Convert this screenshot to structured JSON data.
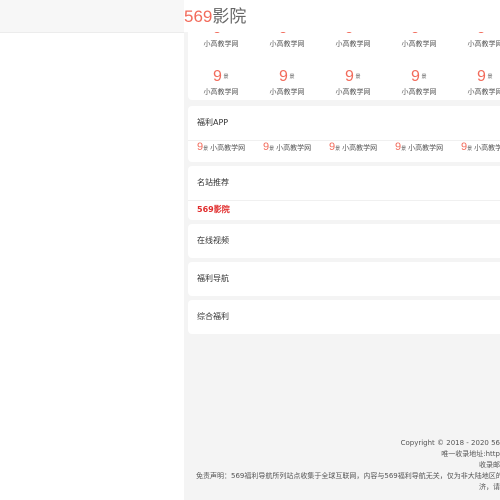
{
  "header": {
    "logo_number": "569",
    "logo_text": "影院"
  },
  "sites": {
    "logo_digit": "9",
    "logo_char": "景",
    "rows": [
      {
        "labels": [
          "小高教学网",
          "小高教学网",
          "小高教学网",
          "小高教学网",
          "小高教学网"
        ]
      },
      {
        "labels": [
          "小高教学网",
          "小高教学网",
          "小高教学网",
          "小高教学网",
          "小高教学网"
        ]
      }
    ]
  },
  "welfare_app": {
    "title": "福利APP",
    "items": [
      "小高教学网",
      "小高教学网",
      "小高教学网",
      "小高教学网",
      "小高教学网"
    ]
  },
  "recommended": {
    "title": "名站推荐",
    "link": "569影院"
  },
  "sections": [
    {
      "title": "在线视频"
    },
    {
      "title": "福利导航"
    },
    {
      "title": "综合福利"
    }
  ],
  "footer": {
    "copyright": "Copyright © 2018 - 2020 56",
    "address": "唯一收录地址:http",
    "mail": "收录邮",
    "disclaimer": "免责声明：569福利导航所列站点收集于全球互联网，内容与569福利导航无关，仅为非大陆地区的",
    "disclaimer2": "济，请"
  },
  "colors": {
    "brand": "#f26b5b",
    "link_red": "#e12d2d",
    "background": "#f4f4f4"
  }
}
